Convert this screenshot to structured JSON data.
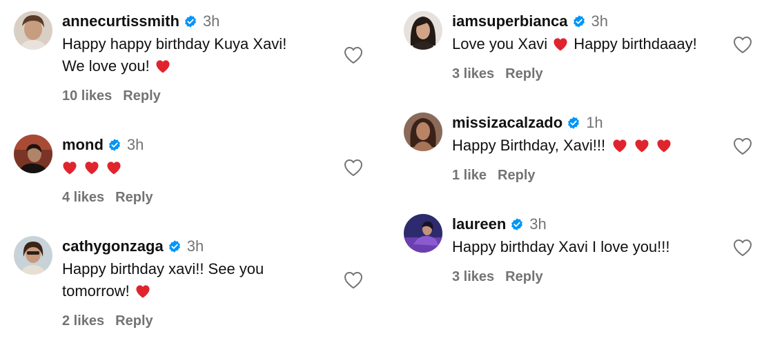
{
  "icons": {
    "verified_color": "#0095F6",
    "heart_emoji_color": "#E0242E",
    "like_outline_color": "#737373"
  },
  "left_column": [
    {
      "username": "annecurtissmith",
      "verified": true,
      "time": "3h",
      "lines": [
        "Happy happy birthday Kuya Xavi!",
        "We love you!"
      ],
      "trailing_hearts": 1,
      "likes": "10 likes",
      "reply": "Reply",
      "avatar_icon": "avatar-photo"
    },
    {
      "username": "mond",
      "verified": true,
      "time": "3h",
      "lines": [
        ""
      ],
      "trailing_hearts": 3,
      "likes": "4 likes",
      "reply": "Reply",
      "avatar_icon": "avatar-photo"
    },
    {
      "username": "cathygonzaga",
      "verified": true,
      "time": "3h",
      "lines": [
        "Happy birthday xavi!! See you",
        "tomorrow!"
      ],
      "trailing_hearts": 1,
      "likes": "2 likes",
      "reply": "Reply",
      "avatar_icon": "avatar-photo"
    }
  ],
  "right_column": [
    {
      "username": "iamsuperbianca",
      "verified": true,
      "time": "3h",
      "text_before": "Love you Xavi",
      "text_after": "Happy birthdaaay!",
      "likes": "3 likes",
      "reply": "Reply",
      "avatar_icon": "avatar-photo"
    },
    {
      "username": "missizacalzado",
      "verified": true,
      "time": "1h",
      "text_before": "Happy Birthday, Xavi!!!",
      "trailing_hearts": 3,
      "likes": "1 like",
      "reply": "Reply",
      "avatar_icon": "avatar-photo"
    },
    {
      "username": "laureen",
      "verified": true,
      "time": "3h",
      "text_before": "Happy birthday Xavi I love you!!!",
      "likes": "3 likes",
      "reply": "Reply",
      "avatar_icon": "avatar-photo"
    }
  ]
}
